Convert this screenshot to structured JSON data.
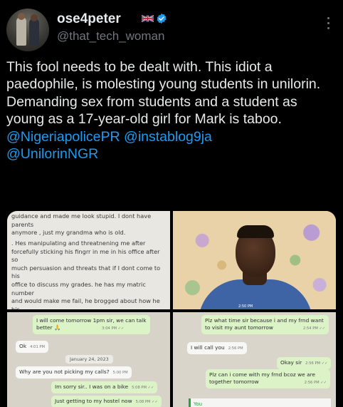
{
  "author": {
    "display_name": "ose4peter",
    "handle": "@that_tech_woman",
    "flag_icon": "uk-flag-icon",
    "verified_icon": "verified-badge-icon",
    "verified_color": "#1d9bf0"
  },
  "tweet": {
    "text": "This fool needs to be dealt with. This idiot a paedophile, is molesting young students in unilorin. Demanding sex from students and a student as young as a 17-year-old girl for Mark is taboo.",
    "mentions_line1": "@NigeriapolicePR @instablog9ja",
    "mentions_line2": "@UnilorinNGR",
    "mention_color": "#1d9bf0"
  },
  "media": {
    "note_top": "guidance and made me look stupid. I dont have parents\nanymore , just my grandma who is old.",
    "note_body": ". Hes manipulating and threatnening me after\nforcefully sticking his fingrr in me in his office after so\nmuch persuasion and threats that if I dont come to his\noffice to discuss my grades. he has my matric number\nand would make me fail, he brogged about how he his\nconnected to all lecturers. all these things scare me a\nlot.",
    "photo_time": "2:50 PM",
    "chat_left": [
      {
        "dir": "out",
        "text": "I will come tomorrow 1pm sir, we can talk",
        "text2": "better 🙏",
        "time": "3:04 PM ✓✓"
      },
      {
        "dir": "in",
        "text": "Ok",
        "time": "4:01 PM"
      },
      {
        "dir": "date",
        "text": "January 24, 2023"
      },
      {
        "dir": "in",
        "text": "Why are you not picking my calls?",
        "time": "5:00 PM"
      },
      {
        "dir": "out",
        "text": "Im sorry sir.. I was on a bike",
        "time": "5:08 PM ✓✓"
      },
      {
        "dir": "out",
        "text": "Just getting to my hostel now",
        "time": "5:08 PM ✓✓"
      }
    ],
    "chat_right": [
      {
        "dir": "out",
        "text": "Plz what time sir because i and my frnd want",
        "text2": "to visit my aunt tomorrow",
        "time": "2:54 PM ✓✓"
      },
      {
        "dir": "in",
        "text": "I will call you",
        "time": "2:56 PM"
      },
      {
        "dir": "out",
        "text": "Okay sir",
        "time": "2:56 PM ✓✓"
      },
      {
        "dir": "out",
        "text": "Plz can i come with my frnd bcoz we are",
        "text2": "together tomorrow",
        "time": "2:56 PM ✓✓"
      },
      {
        "dir": "reply",
        "text": "You"
      }
    ]
  }
}
